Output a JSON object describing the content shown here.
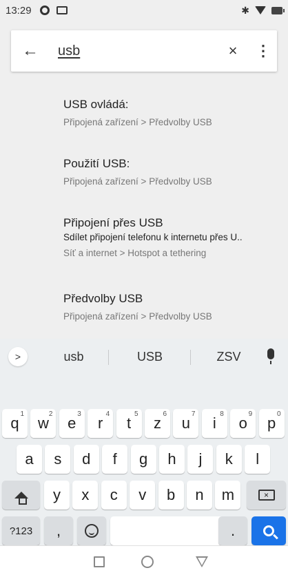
{
  "status_bar": {
    "time": "13:29",
    "icons": [
      "gear-icon",
      "screen-icon",
      "bluetooth-icon",
      "wifi-icon",
      "battery-icon"
    ]
  },
  "search": {
    "query": "usb",
    "back_icon": "←",
    "clear_icon": "×",
    "more_icon": "⋮"
  },
  "results": [
    {
      "title": "USB ovládá:",
      "summary": "",
      "path": "Připojená zařízení > Předvolby USB"
    },
    {
      "title": "Použití USB:",
      "summary": "",
      "path": "Připojená zařízení > Předvolby USB"
    },
    {
      "title": "Připojení přes USB",
      "summary": "Sdílet připojení telefonu k internetu přes U..",
      "path": "Síť a internet > Hotspot a tethering"
    },
    {
      "title": "Předvolby USB",
      "summary": "",
      "path": "Připojená zařízení > Předvolby USB"
    }
  ],
  "keyboard": {
    "suggestions": [
      "usb",
      "USB",
      "ZSV"
    ],
    "suggest_arrow": ">",
    "row1": [
      {
        "label": "q",
        "hint": "1"
      },
      {
        "label": "w",
        "hint": "2"
      },
      {
        "label": "e",
        "hint": "3"
      },
      {
        "label": "r",
        "hint": "4"
      },
      {
        "label": "t",
        "hint": "5"
      },
      {
        "label": "z",
        "hint": "6"
      },
      {
        "label": "u",
        "hint": "7"
      },
      {
        "label": "i",
        "hint": "8"
      },
      {
        "label": "o",
        "hint": "9"
      },
      {
        "label": "p",
        "hint": "0"
      }
    ],
    "row2": [
      "a",
      "s",
      "d",
      "f",
      "g",
      "h",
      "j",
      "k",
      "l"
    ],
    "row3": [
      "y",
      "x",
      "c",
      "v",
      "b",
      "n",
      "m"
    ],
    "symbols_label": "?123",
    "comma_label": ",",
    "period_label": ".",
    "search_color": "#1a73e8"
  },
  "nav": {
    "icons": [
      "recents-icon",
      "home-icon",
      "back-triangle-icon"
    ]
  }
}
